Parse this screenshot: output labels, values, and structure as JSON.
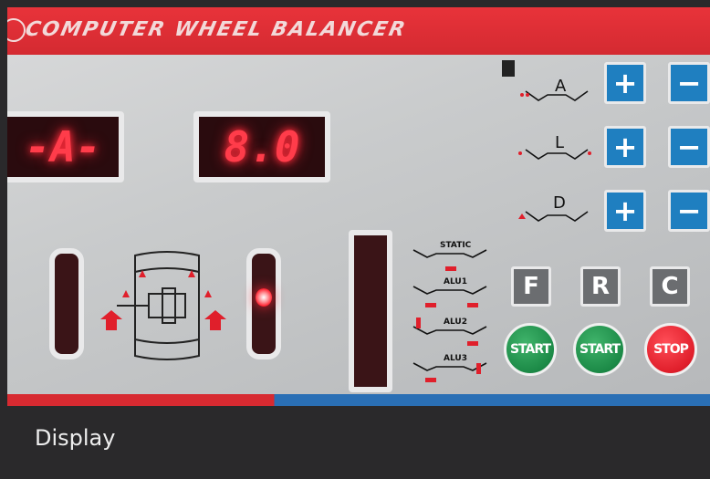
{
  "banner": {
    "title": "COMPUTER WHEEL BALANCER"
  },
  "displays": {
    "left_readout": "-A-",
    "right_readout": "8.0"
  },
  "dimensions": [
    {
      "label": "A",
      "plus": "+",
      "minus": "−"
    },
    {
      "label": "L",
      "plus": "+",
      "minus": "−"
    },
    {
      "label": "D",
      "plus": "+",
      "minus": "−"
    }
  ],
  "modes": [
    "STATIC",
    "ALU1",
    "ALU2",
    "ALU3"
  ],
  "function_buttons": [
    "F",
    "R",
    "C"
  ],
  "action_buttons": [
    {
      "label": "START",
      "color": "#1c8a47"
    },
    {
      "label": "START",
      "color": "#1c8a47"
    },
    {
      "label": "STOP",
      "color": "#e01f2b"
    }
  ],
  "caption": "Display",
  "colors": {
    "panel_red": "#d42a31",
    "button_blue": "#1f7fc0",
    "led_red": "#ff3c4a",
    "caption_bar": "#2a292b"
  }
}
